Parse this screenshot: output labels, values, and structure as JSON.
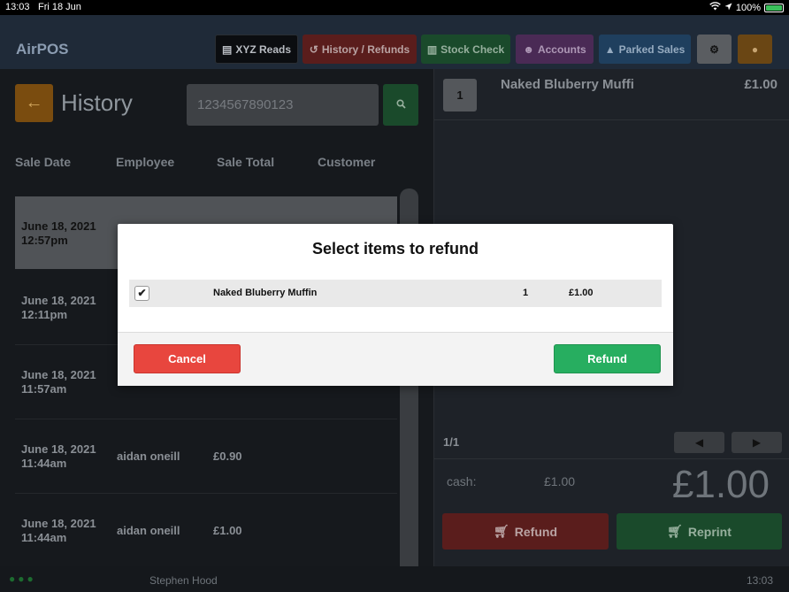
{
  "statusbar": {
    "time": "13:03",
    "date": "Fri 18 Jun",
    "battery": "100%"
  },
  "app": {
    "brand": "AirPOS"
  },
  "nav": {
    "xyz_reads": "XYZ Reads",
    "history_refunds": "History / Refunds",
    "stock_check": "Stock Check",
    "accounts": "Accounts",
    "parked_sales": "Parked Sales"
  },
  "history": {
    "title": "History",
    "search_value": "1234567890123",
    "columns": [
      "Sale Date",
      "Employee",
      "Sale Total",
      "Customer"
    ],
    "rows": [
      {
        "date": "June 18, 2021",
        "time": "12:57pm",
        "employee": "",
        "total": ""
      },
      {
        "date": "June 18, 2021",
        "time": "12:11pm",
        "employee": "",
        "total": ""
      },
      {
        "date": "June 18, 2021",
        "time": "11:57am",
        "employee": "",
        "total": ""
      },
      {
        "date": "June 18, 2021",
        "time": "11:44am",
        "employee": "aidan oneill",
        "total": "£0.90"
      },
      {
        "date": "June 18, 2021",
        "time": "11:44am",
        "employee": "aidan oneill",
        "total": "£1.00"
      }
    ]
  },
  "sale": {
    "item_qty": "1",
    "item_name": "Naked Bluberry Muffi",
    "item_price": "£1.00",
    "pager": "1/1",
    "cash_label": "cash:",
    "cash_value": "£1.00",
    "total": "£1.00",
    "refund_label": "Refund",
    "reprint_label": "Reprint"
  },
  "footer": {
    "user": "Stephen Hood",
    "clock": "13:03"
  },
  "modal": {
    "title": "Select items to refund",
    "item": {
      "checked": "✔",
      "name": "Naked Bluberry Muffin",
      "qty": "1",
      "price": "£1.00"
    },
    "cancel_label": "Cancel",
    "refund_label": "Refund"
  }
}
